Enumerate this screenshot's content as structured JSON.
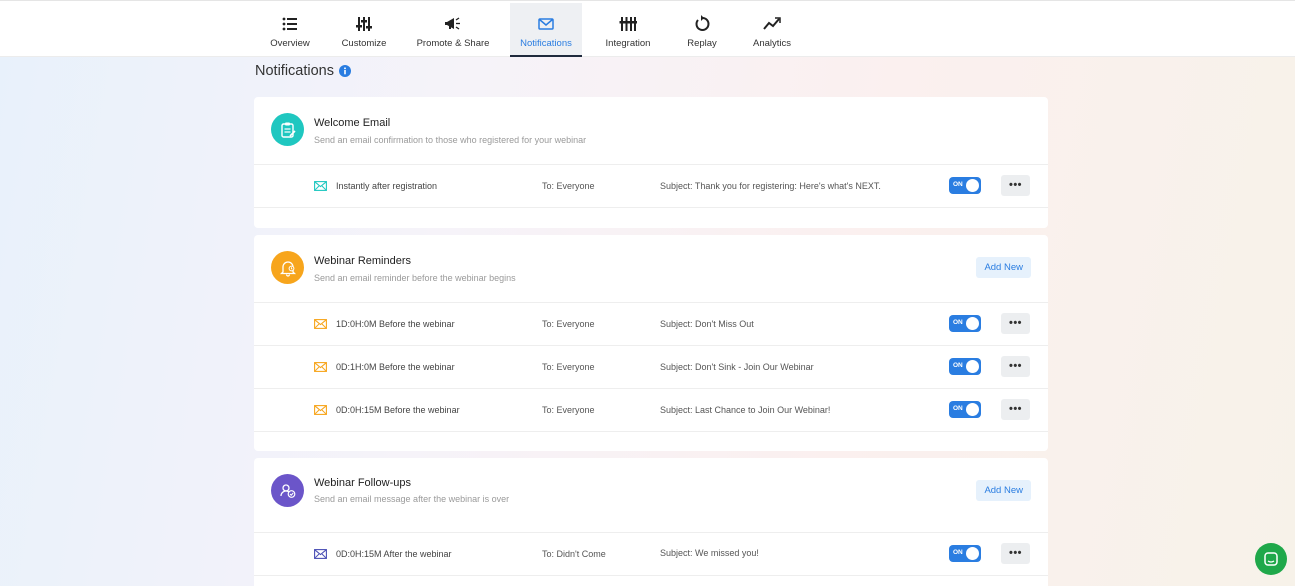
{
  "nav": {
    "tabs": [
      {
        "label": "Overview",
        "icon": "list-icon"
      },
      {
        "label": "Customize",
        "icon": "sliders-icon"
      },
      {
        "label": "Promote & Share",
        "icon": "megaphone-icon"
      },
      {
        "label": "Notifications",
        "icon": "envelope-icon",
        "active": true
      },
      {
        "label": "Integration",
        "icon": "integration-icon"
      },
      {
        "label": "Replay",
        "icon": "replay-icon"
      },
      {
        "label": "Analytics",
        "icon": "analytics-icon"
      }
    ]
  },
  "page": {
    "title": "Notifications"
  },
  "sections": [
    {
      "title": "Welcome Email",
      "subtitle": "Send an email confirmation to those who registered for your webinar",
      "icon": "clipboard-icon",
      "icon_color": "#1fc7c0",
      "rows": [
        {
          "when": "Instantly after registration",
          "to": "To: Everyone",
          "subject": "Subject: Thank you for registering: Here's what's NEXT.",
          "toggle": "ON"
        }
      ]
    },
    {
      "title": "Webinar Reminders",
      "subtitle": "Send an email reminder before the webinar begins",
      "icon": "bell-icon",
      "icon_color": "#f7a51c",
      "add_label": "Add New",
      "rows": [
        {
          "when": "1D:0H:0M Before the webinar",
          "to": "To: Everyone",
          "subject": "Subject: Don't Miss Out",
          "toggle": "ON"
        },
        {
          "when": "0D:1H:0M Before the webinar",
          "to": "To: Everyone",
          "subject": "Subject: Don't Sink - Join Our Webinar",
          "toggle": "ON"
        },
        {
          "when": "0D:0H:15M Before the webinar",
          "to": "To: Everyone",
          "subject": "Subject: Last Chance to Join Our Webinar!",
          "toggle": "ON"
        }
      ]
    },
    {
      "title": "Webinar Follow-ups",
      "subtitle": "Send an email message after the webinar is over",
      "icon": "follow-up-icon",
      "icon_color": "#6b55c9",
      "add_label": "Add New",
      "rows": [
        {
          "when": "0D:0H:15M After the webinar",
          "to": "To: Didn't Come",
          "subject": "Subject: We missed you!",
          "toggle": "ON"
        }
      ]
    }
  ],
  "colors": {
    "accent": "#2a7de1",
    "teal": "#1fc7c0",
    "orange": "#f7a51c",
    "purple": "#6b55c9",
    "chat": "#1fa84a"
  },
  "more_glyph": "•••"
}
